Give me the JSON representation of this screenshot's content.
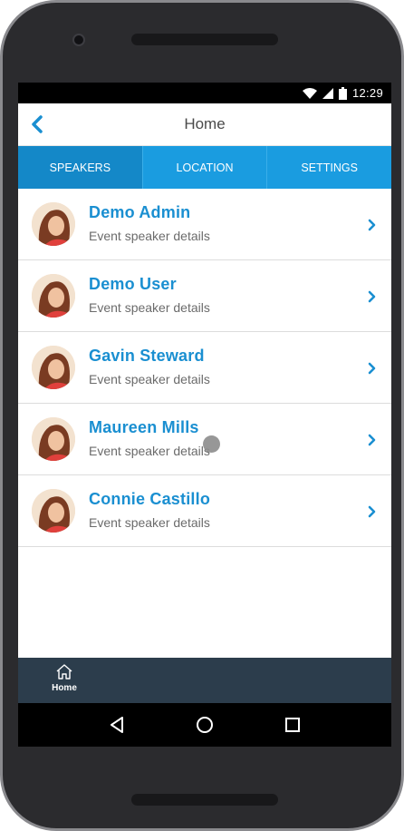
{
  "status_bar": {
    "time": "12:29"
  },
  "header": {
    "title": "Home"
  },
  "tabs": [
    {
      "label": "SPEAKERS",
      "active": true
    },
    {
      "label": "LOCATION",
      "active": false
    },
    {
      "label": "SETTINGS",
      "active": false
    }
  ],
  "speakers": [
    {
      "name": "Demo Admin",
      "subtitle": "Event speaker details"
    },
    {
      "name": "Demo User",
      "subtitle": "Event speaker details"
    },
    {
      "name": "Gavin Steward",
      "subtitle": "Event speaker details"
    },
    {
      "name": "Maureen Mills",
      "subtitle": "Event speaker details"
    },
    {
      "name": "Connie Castillo",
      "subtitle": "Event speaker details"
    }
  ],
  "bottom_nav": {
    "home_label": "Home"
  },
  "colors": {
    "accent": "#1a9ce0",
    "accent_active_tab": "#1488c8",
    "name_text": "#1a8fd1",
    "bottom_nav_bg": "#2c3d4c"
  },
  "icons": {
    "back": "chevron-left-icon",
    "row_chevron": "chevron-right-icon",
    "home": "home-icon",
    "sys_back": "triangle-back-icon",
    "sys_home": "circle-home-icon",
    "sys_recents": "square-recents-icon"
  }
}
